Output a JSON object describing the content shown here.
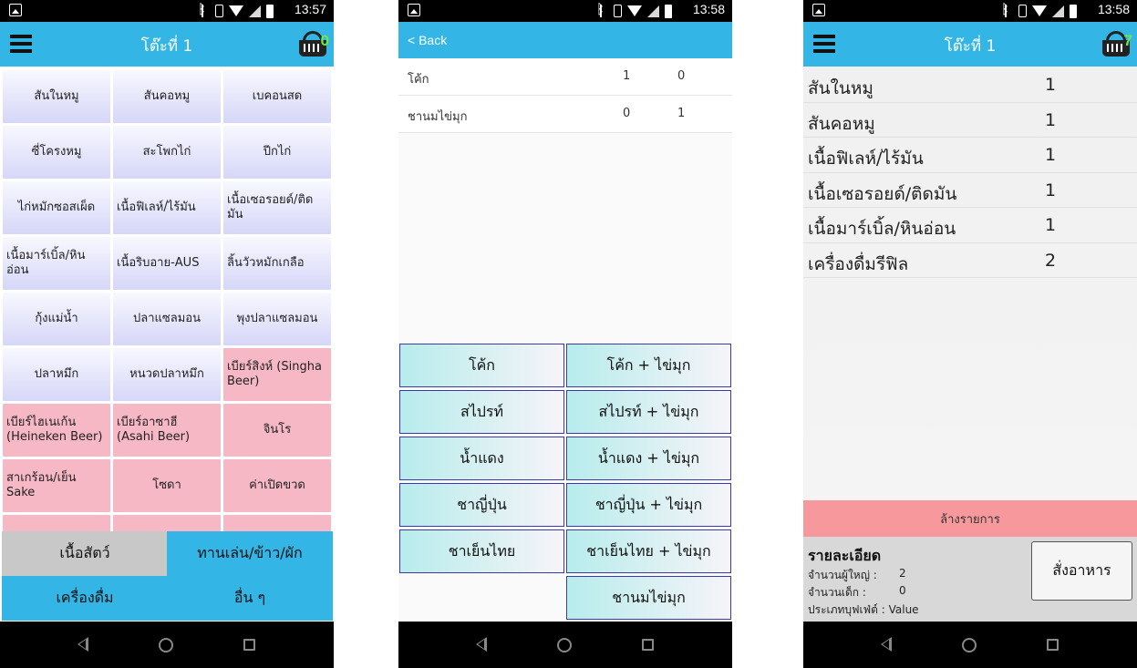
{
  "screen1": {
    "status_time": "13:57",
    "title": "โต๊ะที่ 1",
    "cart_count": "0",
    "menu_items": [
      {
        "label": "สันในหมู",
        "style": "blue"
      },
      {
        "label": "สันคอหมู",
        "style": "blue"
      },
      {
        "label": "เบคอนสด",
        "style": "blue"
      },
      {
        "label": "ซี่โครงหมู",
        "style": "blue"
      },
      {
        "label": "สะโพกไก่",
        "style": "blue"
      },
      {
        "label": "ปีกไก่",
        "style": "blue"
      },
      {
        "label": "ไก่หมักซอสเผ็ด",
        "style": "blue"
      },
      {
        "label": "เนื้อฟิเลห์/ไร้มัน",
        "style": "blue"
      },
      {
        "label": "เนื้อเซอรอยด์/ติดมัน",
        "style": "blue"
      },
      {
        "label": "เนื้อมาร์เบิ้ล/หินอ่อน",
        "style": "blue"
      },
      {
        "label": "เนื้อริบอาย-AUS",
        "style": "blue"
      },
      {
        "label": "ลิ้นวัวหมักเกลือ",
        "style": "blue"
      },
      {
        "label": "กุ้งแม่น้ำ",
        "style": "blue"
      },
      {
        "label": "ปลาแซลมอน",
        "style": "blue"
      },
      {
        "label": "พุงปลาแซลมอน",
        "style": "blue"
      },
      {
        "label": "ปลาหมึก",
        "style": "blue"
      },
      {
        "label": "หนวดปลาหมึก",
        "style": "blue"
      },
      {
        "label": "เบียร์สิงห์ (Singha Beer)",
        "style": "pink"
      },
      {
        "label": "เบียร์ไฮเนเก้น (Heineken Beer)",
        "style": "pink"
      },
      {
        "label": "เบียร์อาซาฮี (Asahi Beer)",
        "style": "pink"
      },
      {
        "label": "จินโร",
        "style": "pink"
      },
      {
        "label": "สาเกร้อน/เย็น Sake",
        "style": "pink"
      },
      {
        "label": "โซดา",
        "style": "pink"
      },
      {
        "label": "ค่าเปิดขวด",
        "style": "pink"
      }
    ],
    "category_tabs": [
      "เนื้อสัตว์",
      "ทานเล่น/ข้าว/ผัก",
      "เครื่องดื่ม",
      "อื่น ๆ"
    ]
  },
  "screen2": {
    "status_time": "13:58",
    "back_label": "< Back",
    "drink_rows": [
      {
        "name": "โค้ก",
        "q1": "1",
        "q2": "0"
      },
      {
        "name": "ชานมไข่มุก",
        "q1": "0",
        "q2": "1"
      }
    ],
    "drink_buttons": [
      "โค้ก",
      "โค้ก + ไข่มุก",
      "สไปรท์",
      "สไปรท์ + ไข่มุก",
      "น้ำแดง",
      "น้ำแดง + ไข่มุก",
      "ชาญี่ปุ่น",
      "ชาญี่ปุ่น + ไข่มุก",
      "ชาเย็นไทย",
      "ชาเย็นไทย + ไข่มุก",
      "ชานมไข่มุก"
    ]
  },
  "screen3": {
    "status_time": "13:58",
    "title": "โต๊ะที่ 1",
    "cart_count": "7",
    "order_items": [
      {
        "name": "สันในหมู",
        "qty": "1"
      },
      {
        "name": "สันคอหมู",
        "qty": "1"
      },
      {
        "name": "เนื้อฟิเลห์/ไร้มัน",
        "qty": "1"
      },
      {
        "name": "เนื้อเซอรอยด์/ติดมัน",
        "qty": "1"
      },
      {
        "name": "เนื้อมาร์เบิ้ล/หินอ่อน",
        "qty": "1"
      },
      {
        "name": "เครื่องดื่มรีฟิล",
        "qty": "2"
      }
    ],
    "clear_label": "ล้างรายการ",
    "detail_title": "รายละเอียด",
    "adults_label": "จำนวนผู้ใหญ่ :",
    "adults_value": "2",
    "children_label": "จำนวนเด็ก :",
    "children_value": "0",
    "buffet_label": "ประเภทบุฟเฟ่ต์ : Value",
    "order_button": "สั่งอาหาร"
  },
  "colors": {
    "header": "#33b5e5",
    "meat_button": "#d6d6f8",
    "drink_button": "#f7b8c5",
    "clear_bar": "#f7999c",
    "cart_badge": "#6ee84a"
  }
}
